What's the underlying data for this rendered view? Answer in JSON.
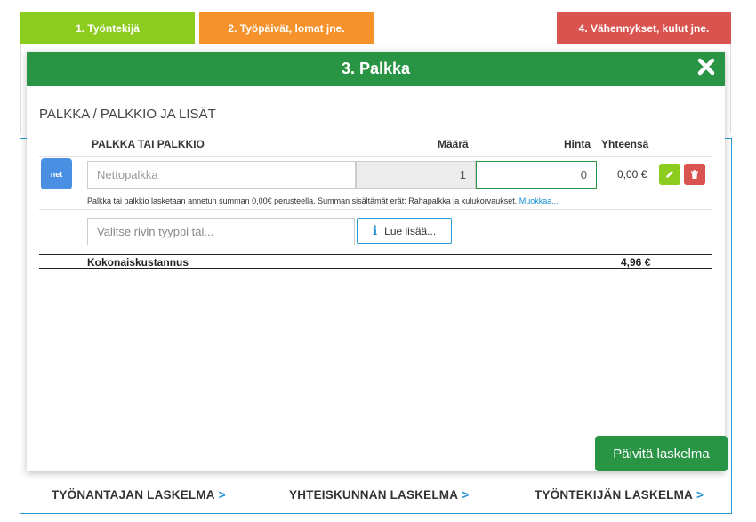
{
  "steps": {
    "tab1": "1. Työntekijä",
    "tab2": "2. Työpäivät, lomat jne.",
    "tab4": "4. Vähennykset, kulut jne."
  },
  "modal": {
    "title": "3. Palkka",
    "section_title": "PALKKA / PALKKIO JA LISÄT",
    "columns": {
      "name": "PALKKA TAI PALKKIO",
      "qty": "Määrä",
      "price": "Hinta",
      "total": "Yhteensä"
    },
    "row": {
      "badge": "net",
      "name_placeholder": "Nettopalkka",
      "qty": "1",
      "price": "0",
      "total": "0,00 €",
      "note": "Palkka tai palkkio lasketaan annetun summan 0,00€ perusteella. Summan sisältämät erät: Rahapalkka ja kulukorvaukset.",
      "note_link": "Muokkaa..."
    },
    "type_placeholder": "Valitse rivin tyyppi tai...",
    "read_more": "Lue lisää...",
    "total_label": "Kokonaiskustannus",
    "total_value": "4,96 €",
    "update_button": "Päivitä laskelma"
  },
  "bottom_nav": {
    "employer": "TYÖNANTAJAN LASKELMA",
    "society": "YHTEISKUNNAN LASKELMA",
    "employee": "TYÖNTEKIJÄN LASKELMA",
    "arrow": ">"
  },
  "colors": {
    "header_green": "#2a9445",
    "tab1": "#8ccc1f",
    "tab2": "#f5922c",
    "tab4": "#d9534f",
    "link_blue": "#1a8fd0"
  },
  "icons": {
    "close": "close-icon",
    "edit": "pencil-icon",
    "delete": "trash-icon",
    "info": "info-icon"
  }
}
